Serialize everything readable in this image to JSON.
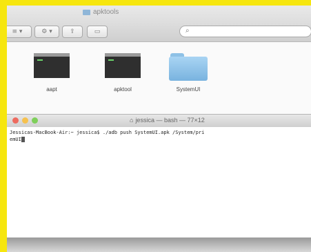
{
  "finder": {
    "title": "apktools",
    "search": {
      "placeholder": ""
    },
    "items": [
      {
        "label": "aapt",
        "kind": "exec-icon"
      },
      {
        "label": "apktool",
        "kind": "exec-icon"
      },
      {
        "label": "SystemUI",
        "kind": "folder-icon"
      }
    ]
  },
  "terminal": {
    "title": "jessica — bash — 77×12",
    "line1": "Jessicas-MacBook-Air:~ jessica$ ./adb push SystemUI.apk /System/pri",
    "line2": "emUI"
  },
  "colors": {
    "background": "#f6e60e",
    "folder": "#79b3df"
  }
}
